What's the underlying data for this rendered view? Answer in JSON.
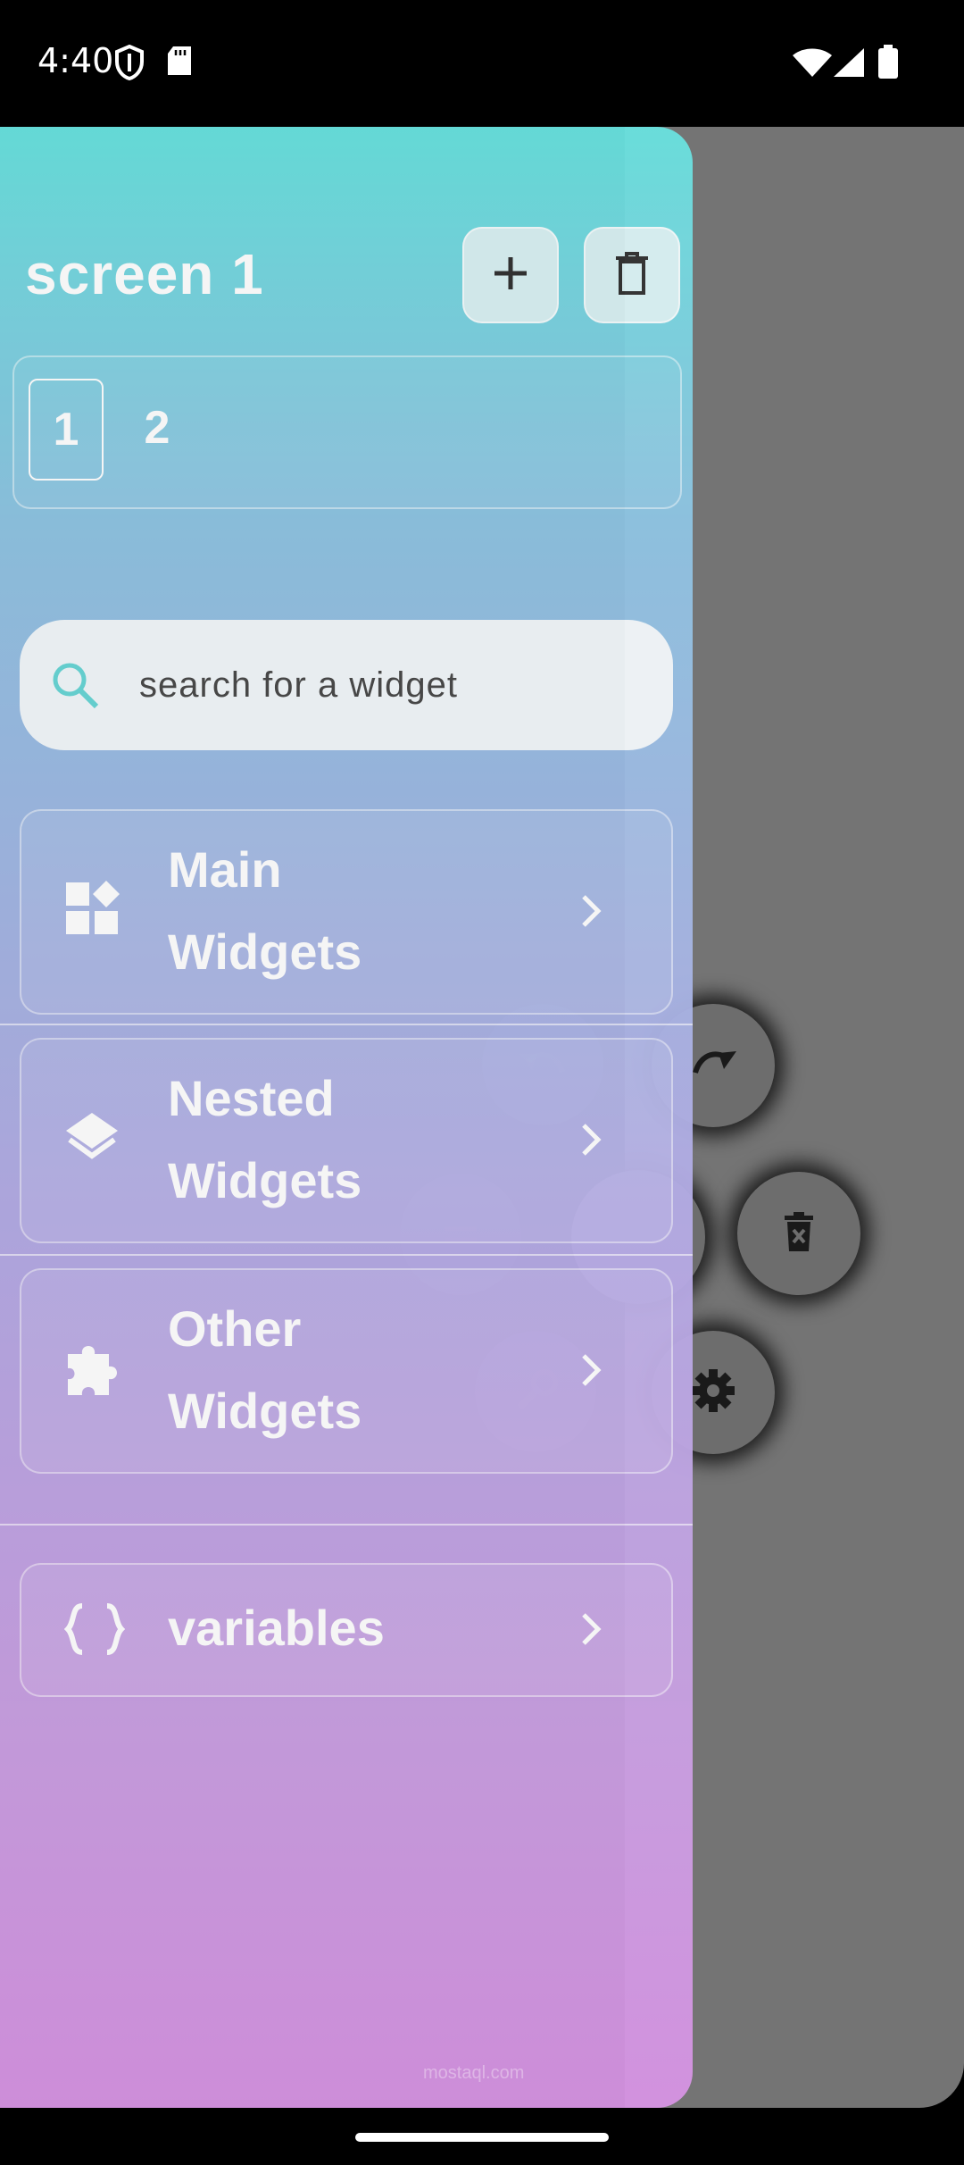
{
  "status_bar": {
    "time": "4:40",
    "icons": [
      "shield-icon",
      "sd-card-icon",
      "wifi-icon",
      "signal-icon",
      "battery-icon"
    ]
  },
  "drawer": {
    "title": "screen 1",
    "add_icon": "plus-icon",
    "delete_icon": "trash-icon",
    "pages": [
      "1",
      "2"
    ],
    "active_page": "1",
    "search": {
      "placeholder": "search for a widget",
      "icon": "search-icon"
    },
    "categories": [
      {
        "line1": "Main",
        "line2": "Widgets",
        "icon": "dashboard-icon"
      },
      {
        "line1": "Nested",
        "line2": "Widgets",
        "icon": "layers-icon"
      },
      {
        "line1": "Other",
        "line2": "Widgets",
        "icon": "puzzle-icon"
      }
    ],
    "variables": {
      "label": "variables",
      "icon": "braces-icon"
    }
  },
  "fab_menu": {
    "buttons": [
      "redo-icon",
      "delete-widget-icon",
      "settings-icon"
    ],
    "ghost_buttons": [
      "undo-icon",
      "menu-icon",
      "wrench-icon"
    ]
  },
  "colors": {
    "gradient_top": "#69e2df",
    "gradient_bottom": "#d693e2",
    "canvas": "#747474"
  },
  "watermark": "mostaql.com"
}
